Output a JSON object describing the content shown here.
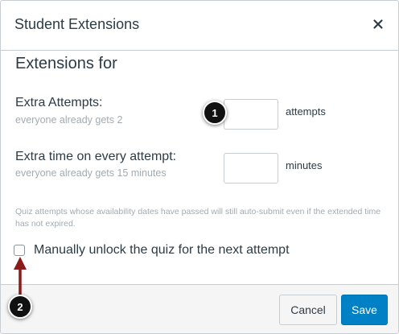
{
  "dialog": {
    "title": "Student Extensions",
    "close_icon": "close-icon"
  },
  "content": {
    "section_title": "Extensions for",
    "extra_attempts": {
      "label": "Extra Attempts:",
      "hint": "everyone already gets 2",
      "value": "",
      "unit": "attempts"
    },
    "extra_time": {
      "label": "Extra time on every attempt:",
      "hint": "everyone already gets 15 minutes",
      "value": "",
      "unit": "minutes"
    },
    "note": "Quiz attempts whose availability dates have passed will still auto-submit even if the extended time has not expired.",
    "unlock": {
      "label": "Manually unlock the quiz for the next attempt",
      "checked": false
    }
  },
  "footer": {
    "cancel_label": "Cancel",
    "save_label": "Save"
  },
  "callouts": {
    "one": "1",
    "two": "2"
  },
  "colors": {
    "primary": "#0081c6",
    "text": "#2d3b45",
    "muted": "#a3abb1",
    "border": "#c7cdd1",
    "arrow": "#8b1a1a",
    "callout": "#111111"
  }
}
